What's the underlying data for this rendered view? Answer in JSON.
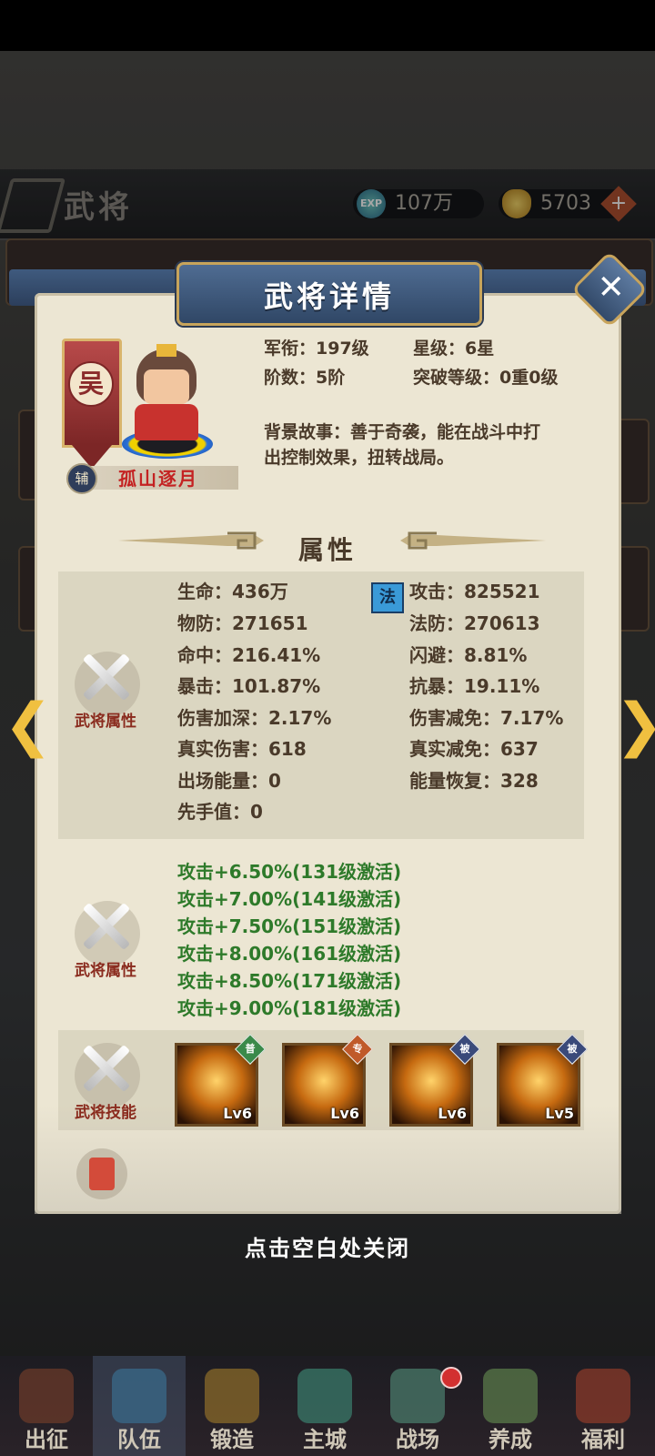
{
  "topbar": {
    "title": "武将",
    "exp_label": "EXP",
    "exp_value": "107万",
    "gold_value": "5703",
    "plus_icon": "+"
  },
  "dialog": {
    "title": "武将详情",
    "close_glyph": "✕",
    "faction": "吴",
    "role_badge": "辅",
    "general_name": "孤山逐月",
    "info": {
      "rank": "军衔：197级",
      "star": "星级：6星",
      "stage": "阶数：5阶",
      "breakthrough": "突破等级：0重0级",
      "story_line1": "背景故事：善于奇袭，能在战斗中打",
      "story_line2": "出控制效果，扭转战局。"
    },
    "section_title": "属性",
    "side_label_attr": "武将属性",
    "side_label_attr2": "武将属性",
    "side_label_skill": "武将技能",
    "attack_type_tag": "法",
    "stats_left": [
      "生命：436万",
      "物防：271651",
      "命中：216.41%",
      "暴击：101.87%",
      "伤害加深：2.17%",
      "真实伤害：618",
      "出场能量：0",
      "先手值：0"
    ],
    "stats_right": [
      "攻击：825521",
      "法防：270613",
      "闪避：8.81%",
      "抗暴：19.11%",
      "伤害减免：7.17%",
      "真实减免：637",
      "能量恢复：328"
    ],
    "bonuses": [
      "攻击+6.50%(131级激活)",
      "攻击+7.00%(141级激活)",
      "攻击+7.50%(151级激活)",
      "攻击+8.00%(161级激活)",
      "攻击+8.50%(171级激活)",
      "攻击+9.00%(181级激活)"
    ],
    "skills": [
      {
        "tag": "普",
        "level": "Lv6",
        "tag_color": "#3a8a4a"
      },
      {
        "tag": "专",
        "level": "Lv6",
        "tag_color": "#c05a2a"
      },
      {
        "tag": "被",
        "level": "Lv6",
        "tag_color": "#3a4a7a"
      },
      {
        "tag": "被",
        "level": "Lv5",
        "tag_color": "#3a4a7a"
      }
    ],
    "close_hint": "点击空白处关闭"
  },
  "nav": {
    "items": [
      "出征",
      "队伍",
      "锻造",
      "主城",
      "战场",
      "养成",
      "福利"
    ]
  }
}
